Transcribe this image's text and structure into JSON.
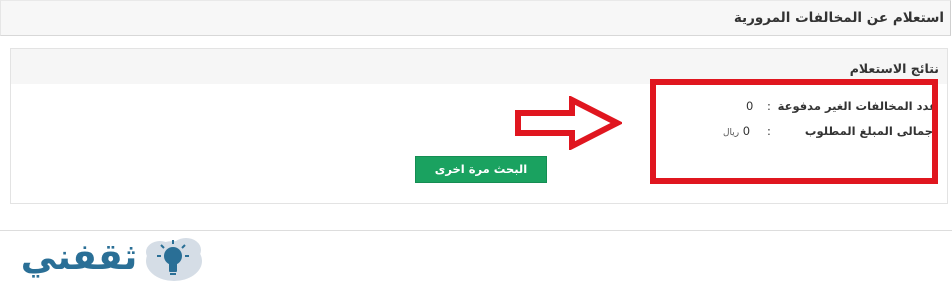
{
  "header": {
    "title": "استعلام عن المخالفات المرورية"
  },
  "results": {
    "title": "نتائج الاستعلام",
    "rows": [
      {
        "label": "عدد المخالفات الغير مدفوعة",
        "colon": ":",
        "value": "0",
        "unit": ""
      },
      {
        "label": "إجمالى المبلغ المطلوب",
        "colon": ":",
        "value": "0",
        "unit": "ريال"
      }
    ],
    "search_again_label": "البحث مرة اخرى"
  },
  "logo": {
    "text": "ثقفني"
  },
  "colors": {
    "accent_button": "#1aa260",
    "annotation_red": "#e0161f",
    "logo_blue": "#2a6f96"
  },
  "icons": {
    "annotation_arrow": "arrow-right-icon",
    "logo_bulb": "lightbulb-icon"
  }
}
